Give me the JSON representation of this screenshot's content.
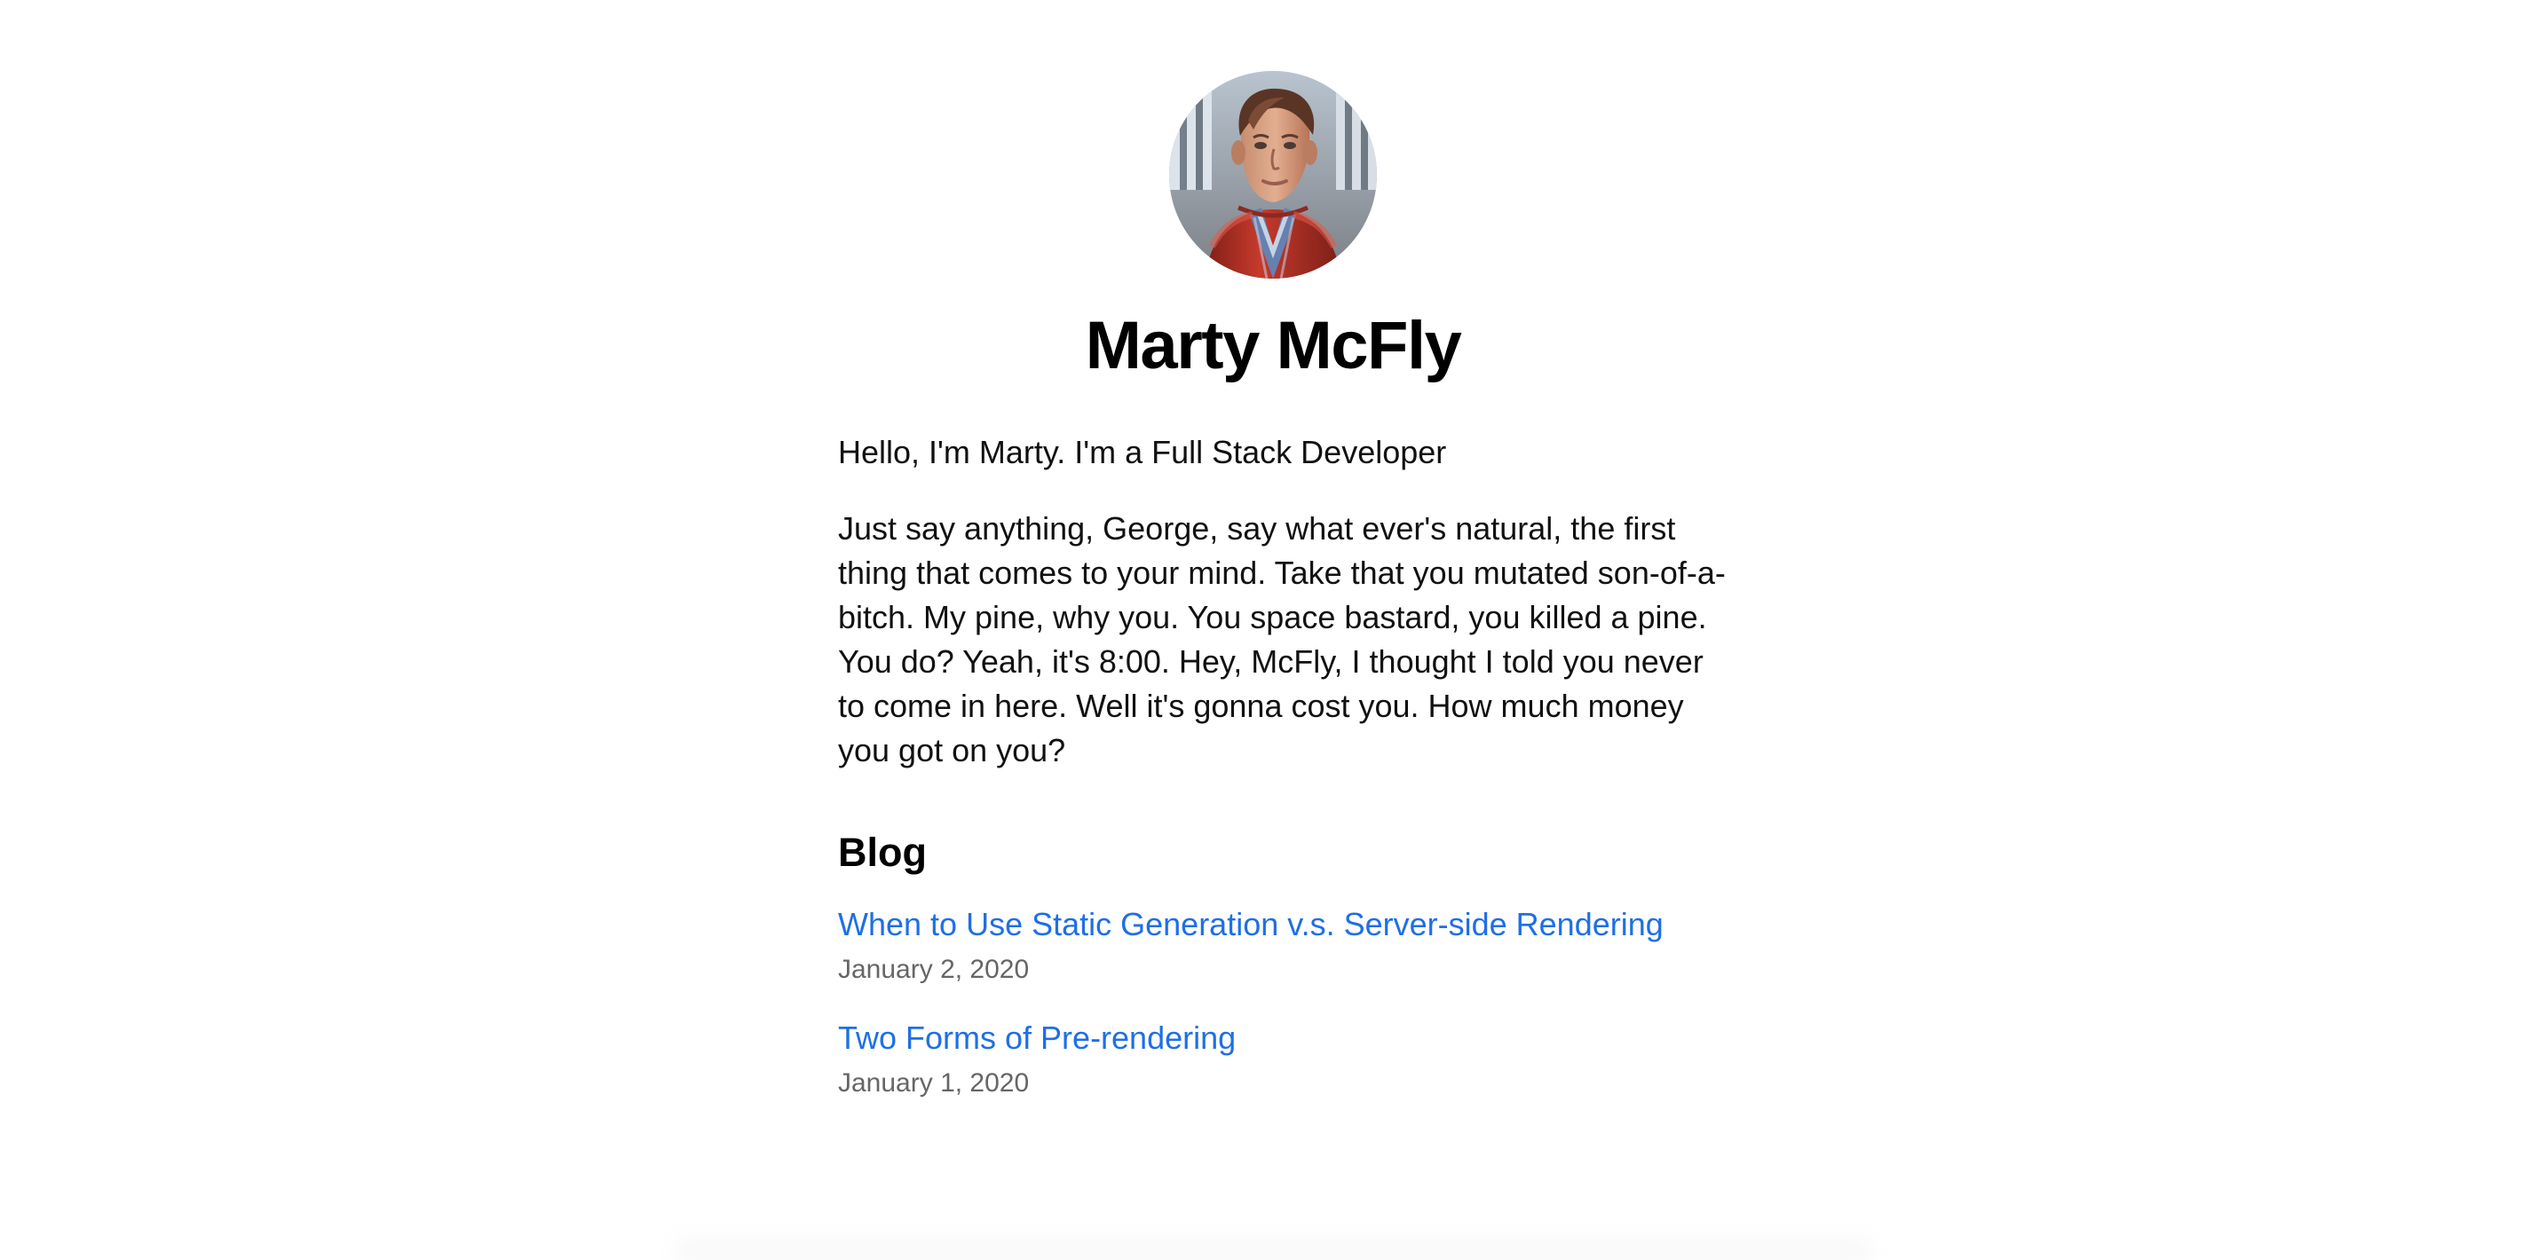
{
  "profile": {
    "name": "Marty McFly",
    "avatar_icon": "profile-photo-icon"
  },
  "content": {
    "intro": "Hello, I'm Marty. I'm a Full Stack Developer",
    "bio": "Just say anything, George, say what ever's natural, the first thing that comes to your mind. Take that you mutated son-of-a-bitch. My pine, why you. You space bastard, you killed a pine. You do? Yeah, it's 8:00. Hey, McFly, I thought I told you never to come in here. Well it's gonna cost you. How much money you got on you?"
  },
  "blog": {
    "title": "Blog",
    "posts": [
      {
        "title": "When to Use Static Generation v.s. Server-side Rendering",
        "date": "January 2, 2020"
      },
      {
        "title": "Two Forms of Pre-rendering",
        "date": "January 1, 2020"
      }
    ]
  },
  "colors": {
    "link": "#1f6fe5",
    "text": "#111111",
    "date": "#666666"
  }
}
